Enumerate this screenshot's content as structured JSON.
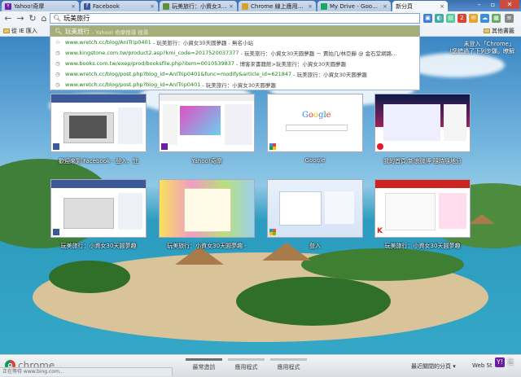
{
  "tabs": [
    {
      "label": "Yahoo!奇摩",
      "icon": "yahoo-icon",
      "color": "#6b1fa3",
      "glyph": "Y"
    },
    {
      "label": "Facebook",
      "icon": "facebook-icon",
      "color": "#3b5998",
      "glyph": "f"
    },
    {
      "label": "玩美旅行：小資女30天圓夢",
      "icon": "blog-icon",
      "color": "#5d8f3e",
      "glyph": "▪"
    },
    {
      "label": "Chrome 線上應用程式",
      "icon": "chrome-webstore-icon",
      "color": "#d9a12b",
      "glyph": "▪"
    },
    {
      "label": "My Drive - Google Drive",
      "icon": "google-drive-icon",
      "color": "#1fa463",
      "glyph": "▲"
    },
    {
      "label": "新分頁",
      "icon": "new-tab-icon",
      "color": "#cccccc",
      "glyph": ""
    }
  ],
  "omnibox": {
    "value": "玩美旅行"
  },
  "bookmarks": {
    "import_label": "從 IE 匯入",
    "other_label": "其他書籤"
  },
  "suggestions": [
    {
      "type": "search",
      "query": "玩美旅行",
      "hint": "- Yahoo! 奇摩搜尋 搜尋"
    },
    {
      "type": "history",
      "url": "www.wretch.cc/blog/AnITrip0401",
      "title": "- 玩美旅行：小資女30天圓夢趣 - 無名小站"
    },
    {
      "type": "history",
      "url": "www.kingstone.com.tw/product2.asp?kmi_code=2017520037377",
      "title": "- 玩美旅行：小資女30天圓夢趣 － 賣拍几/林亞靜 @ 金石堂網路..."
    },
    {
      "type": "history",
      "url": "www.books.com.tw/exep/prod/booksfile.php?item=0010539837",
      "title": "- 博客來書籍館>玩美旅行：小資女30天圓夢趣"
    },
    {
      "type": "history",
      "url": "www.wretch.cc/blog/post.php?blog_id=AnITrip0401&func=modify&article_id=621847",
      "title": "- 玩美旅行：小資女30天圓夢趣"
    },
    {
      "type": "history",
      "url": "www.wretch.cc/blog/post.php?blog_id=AnITrip0401",
      "title": "- 玩美旅行：小資女30天圓夢趣"
    }
  ],
  "signin": {
    "line1": "未登入「Chrome」",
    "line2": "(您錯過了下列步驟。瞭解"
  },
  "thumbnails": [
    {
      "label": "歡迎來到 Facebook - 登入、註"
    },
    {
      "label": "Yahoo!奇摩"
    },
    {
      "label": "Google"
    },
    {
      "label": "我的首頁 新浪微博-隨時隨地分"
    },
    {
      "label": "玩美旅行：小資女30天圓夢趣"
    },
    {
      "label": "玩美旅行：小資女30天圓夢趣 -"
    },
    {
      "label": "登入"
    },
    {
      "label": "玩美旅行：小資女30天圓夢趣"
    }
  ],
  "bottom": {
    "brand": "chrome",
    "nav_tabs": [
      "最常造訪",
      "應用程式",
      "應用程式"
    ],
    "recent_label": "最近關閉的分頁 ▾",
    "webstore_label": "Web St",
    "status": "正在等待 www.bing.com...",
    "zhu": "注"
  }
}
